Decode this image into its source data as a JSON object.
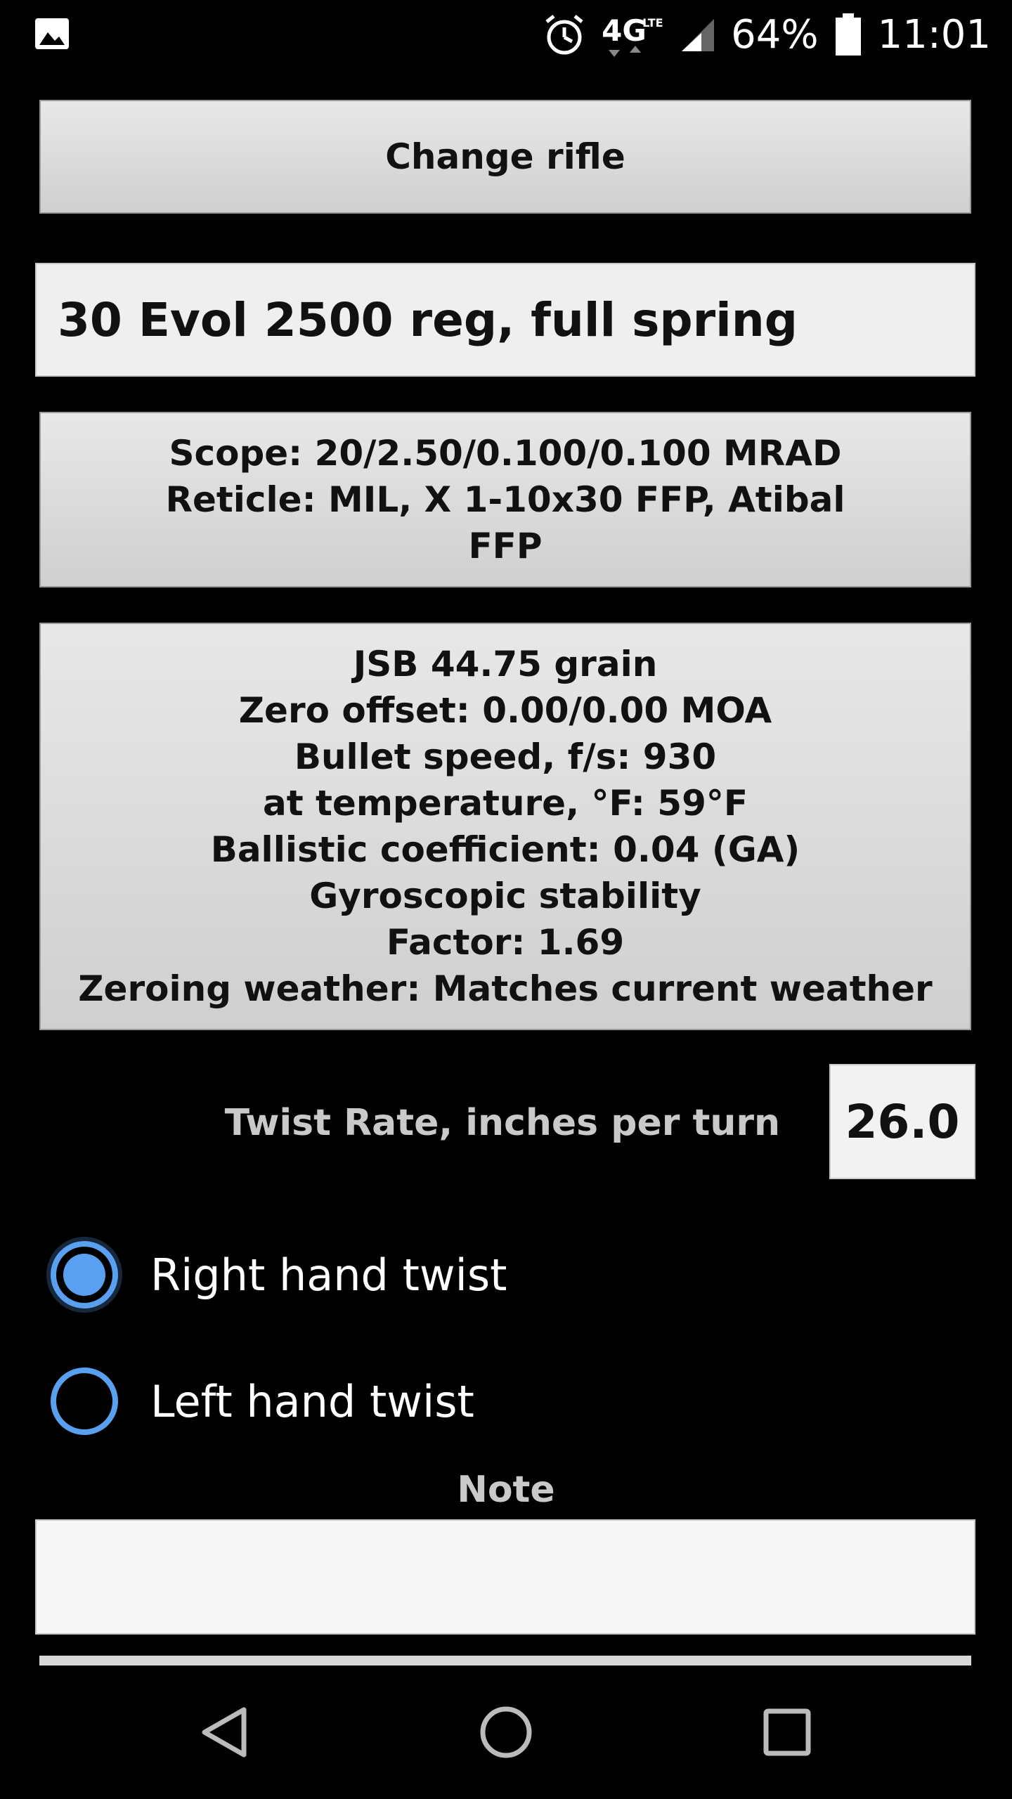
{
  "status_bar": {
    "network": "4G",
    "network_sub": "LTE",
    "battery": "64%",
    "time": "11:01",
    "icons": [
      "image-icon",
      "alarm-icon",
      "signal-icon",
      "battery-icon"
    ]
  },
  "change_rifle_label": "Change rifle",
  "rifle_name": "30 Evol 2500 reg, full spring",
  "scope": {
    "lines": [
      "Scope: 20/2.50/0.100/0.100 MRAD",
      "Reticle: MIL, X 1-10x30 FFP, Atibal",
      "FFP"
    ]
  },
  "ammo": {
    "lines": [
      "JSB 44.75 grain",
      "Zero offset: 0.00/0.00 MOA",
      "Bullet speed, f/s: 930",
      "at temperature, °F: 59°F",
      "Ballistic coefficient: 0.04 (GA)",
      "Gyroscopic stability",
      "Factor: 1.69",
      "Zeroing weather: Matches current weather"
    ]
  },
  "twist": {
    "label": "Twist Rate, inches per turn",
    "value": "26.0"
  },
  "radios": {
    "right_label": "Right hand twist",
    "left_label": "Left hand twist",
    "selected": "right"
  },
  "note": {
    "label": "Note",
    "value": ""
  },
  "colors": {
    "accent": "#5aa0f0",
    "background": "#000000",
    "button_gray": "#d9d9d9",
    "label_gray": "#c9c9c9"
  },
  "nav": {
    "icons": [
      "back-icon",
      "home-icon",
      "recents-icon"
    ]
  }
}
